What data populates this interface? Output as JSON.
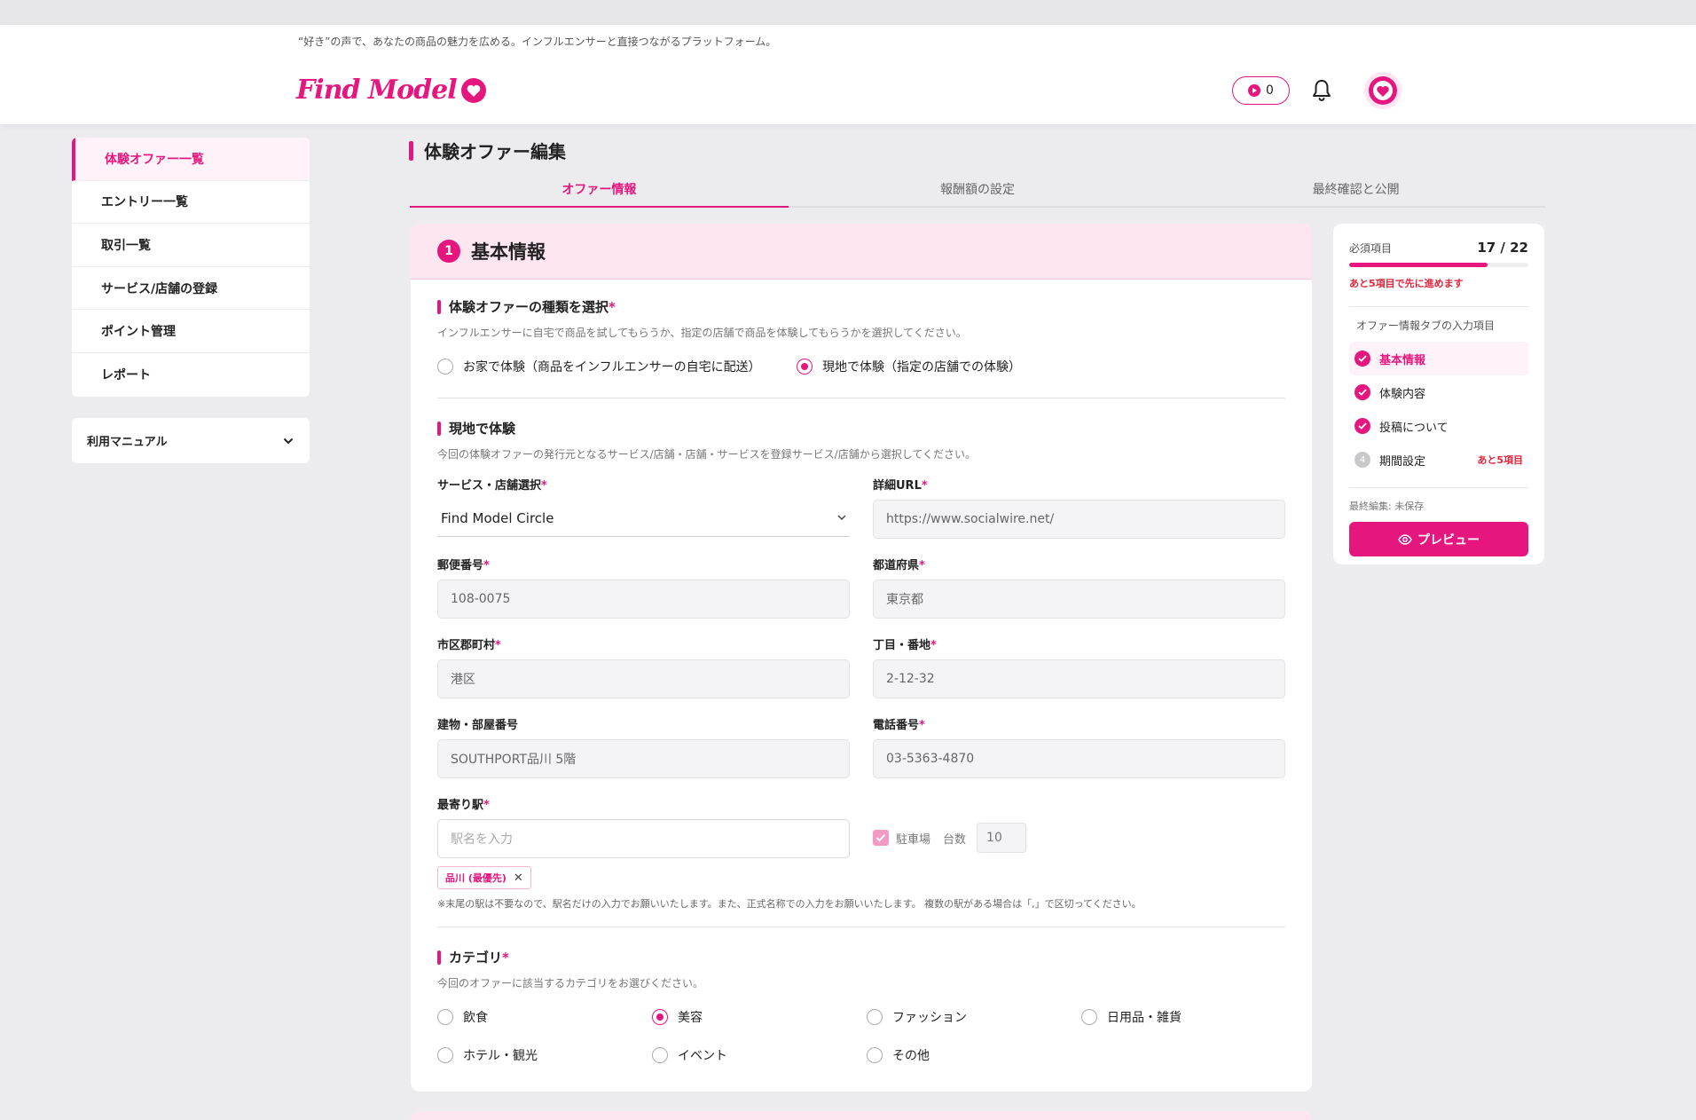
{
  "header": {
    "tagline": "“好き”の声で、あなたの商品の魅力を広める。インフルエンサーと直接つながるプラットフォーム。",
    "logo_text": "Find Model",
    "points": "0",
    "brand_color": "#e5177e"
  },
  "sidebar": {
    "items": [
      {
        "label": "体験オファー一覧"
      },
      {
        "label": "エントリー一覧"
      },
      {
        "label": "取引一覧"
      },
      {
        "label": "サービス/店舗の登録"
      },
      {
        "label": "ポイント管理"
      },
      {
        "label": "レポート"
      }
    ],
    "manual_label": "利用マニュアル"
  },
  "page": {
    "title": "体験オファー編集",
    "tabs": [
      {
        "label": "オファー情報"
      },
      {
        "label": "報酬額の設定"
      },
      {
        "label": "最終確認と公開"
      }
    ]
  },
  "form": {
    "section_number": "1",
    "section_title": "基本情報",
    "offer_type": {
      "title": "体験オファーの種類を選択",
      "required": "*",
      "description": "インフルエンサーに自宅で商品を試してもらうか、指定の店舗で商品を体験してもらうかを選択してください。",
      "options": [
        {
          "label": "お家で体験（商品をインフルエンサーの自宅に配送）"
        },
        {
          "label": "現地で体験（指定の店舗での体験）"
        }
      ]
    },
    "onsite": {
      "title": "現地で体験",
      "description": "今回の体験オファーの発行元となるサービス/店舗・店舗・サービスを登録サービス/店舗から選択してください。",
      "service_label": "サービス・店舗選択",
      "service_value": "Find Model Circle",
      "url_label": "詳細URL",
      "url_value": "https://www.socialwire.net/",
      "zip_label": "郵便番号",
      "zip_value": "108-0075",
      "pref_label": "都道府県",
      "pref_value": "東京都",
      "city_label": "市区郡町村",
      "city_value": "港区",
      "street_label": "丁目・番地",
      "street_value": "2-12-32",
      "building_label": "建物・部屋番号",
      "building_value": "SOUTHPORT品川 5階",
      "phone_label": "電話番号",
      "phone_value": "03-5363-4870",
      "station_label": "最寄り駅",
      "station_placeholder": "駅名を入力",
      "parking_label": "駐車場",
      "count_label": "台数",
      "count_value": "10",
      "station_tag": "品川 (最優先)",
      "station_note": "※末尾の駅は不要なので、駅名だけの入力でお願いいたします。また、正式名称での入力をお願いいたします。 複数の駅がある場合は「,」で区切ってください。"
    },
    "category": {
      "title": "カテゴリ",
      "description": "今回のオファーに該当するカテゴリをお選びください。",
      "options": [
        {
          "label": "飲食"
        },
        {
          "label": "美容"
        },
        {
          "label": "ファッション"
        },
        {
          "label": "日用品・雑貨"
        },
        {
          "label": "ホテル・観光"
        },
        {
          "label": "イベント"
        },
        {
          "label": "その他"
        }
      ],
      "selected": "美容"
    }
  },
  "progress": {
    "label": "必須項目",
    "count": "17 / 22",
    "fraction": 0.773,
    "warning": "あと5項目で先に進めます",
    "sub_title": "オファー情報タブの入力項目",
    "items": [
      {
        "label": "基本情報"
      },
      {
        "label": "体験内容"
      },
      {
        "label": "投稿について"
      },
      {
        "label": "期間設定",
        "number": "4",
        "remain": "あと5項目"
      }
    ],
    "last_edit": "最終編集: 未保存",
    "preview_label": "プレビュー"
  }
}
